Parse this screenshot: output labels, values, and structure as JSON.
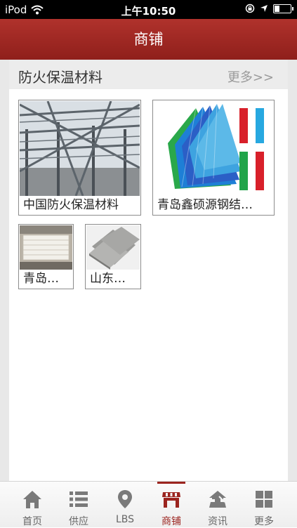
{
  "statusbar": {
    "device": "iPod",
    "time": "上午10:50"
  },
  "navbar": {
    "title": "商铺"
  },
  "section": {
    "title": "防火保温材料",
    "more_label": "更多>>",
    "shops": [
      {
        "name": "中国防火保温材料",
        "image": "steel-frame-structure"
      },
      {
        "name": "青岛鑫硕源钢结…",
        "image": "colored-steel-sheets"
      },
      {
        "name": "青岛…",
        "image": "insulation-panel-stack"
      },
      {
        "name": "山东…",
        "image": "gray-board-panels"
      }
    ]
  },
  "tabbar": {
    "active": "商铺",
    "items": [
      {
        "label": "首页",
        "icon": "home-icon"
      },
      {
        "label": "供应",
        "icon": "list-icon"
      },
      {
        "label": "LBS",
        "icon": "location-pin-icon"
      },
      {
        "label": "商铺",
        "icon": "shop-icon"
      },
      {
        "label": "资讯",
        "icon": "news-icon"
      },
      {
        "label": "更多",
        "icon": "grid-icon"
      }
    ]
  },
  "colors": {
    "brand": "#9b241f",
    "navbar": "#a12a25"
  }
}
